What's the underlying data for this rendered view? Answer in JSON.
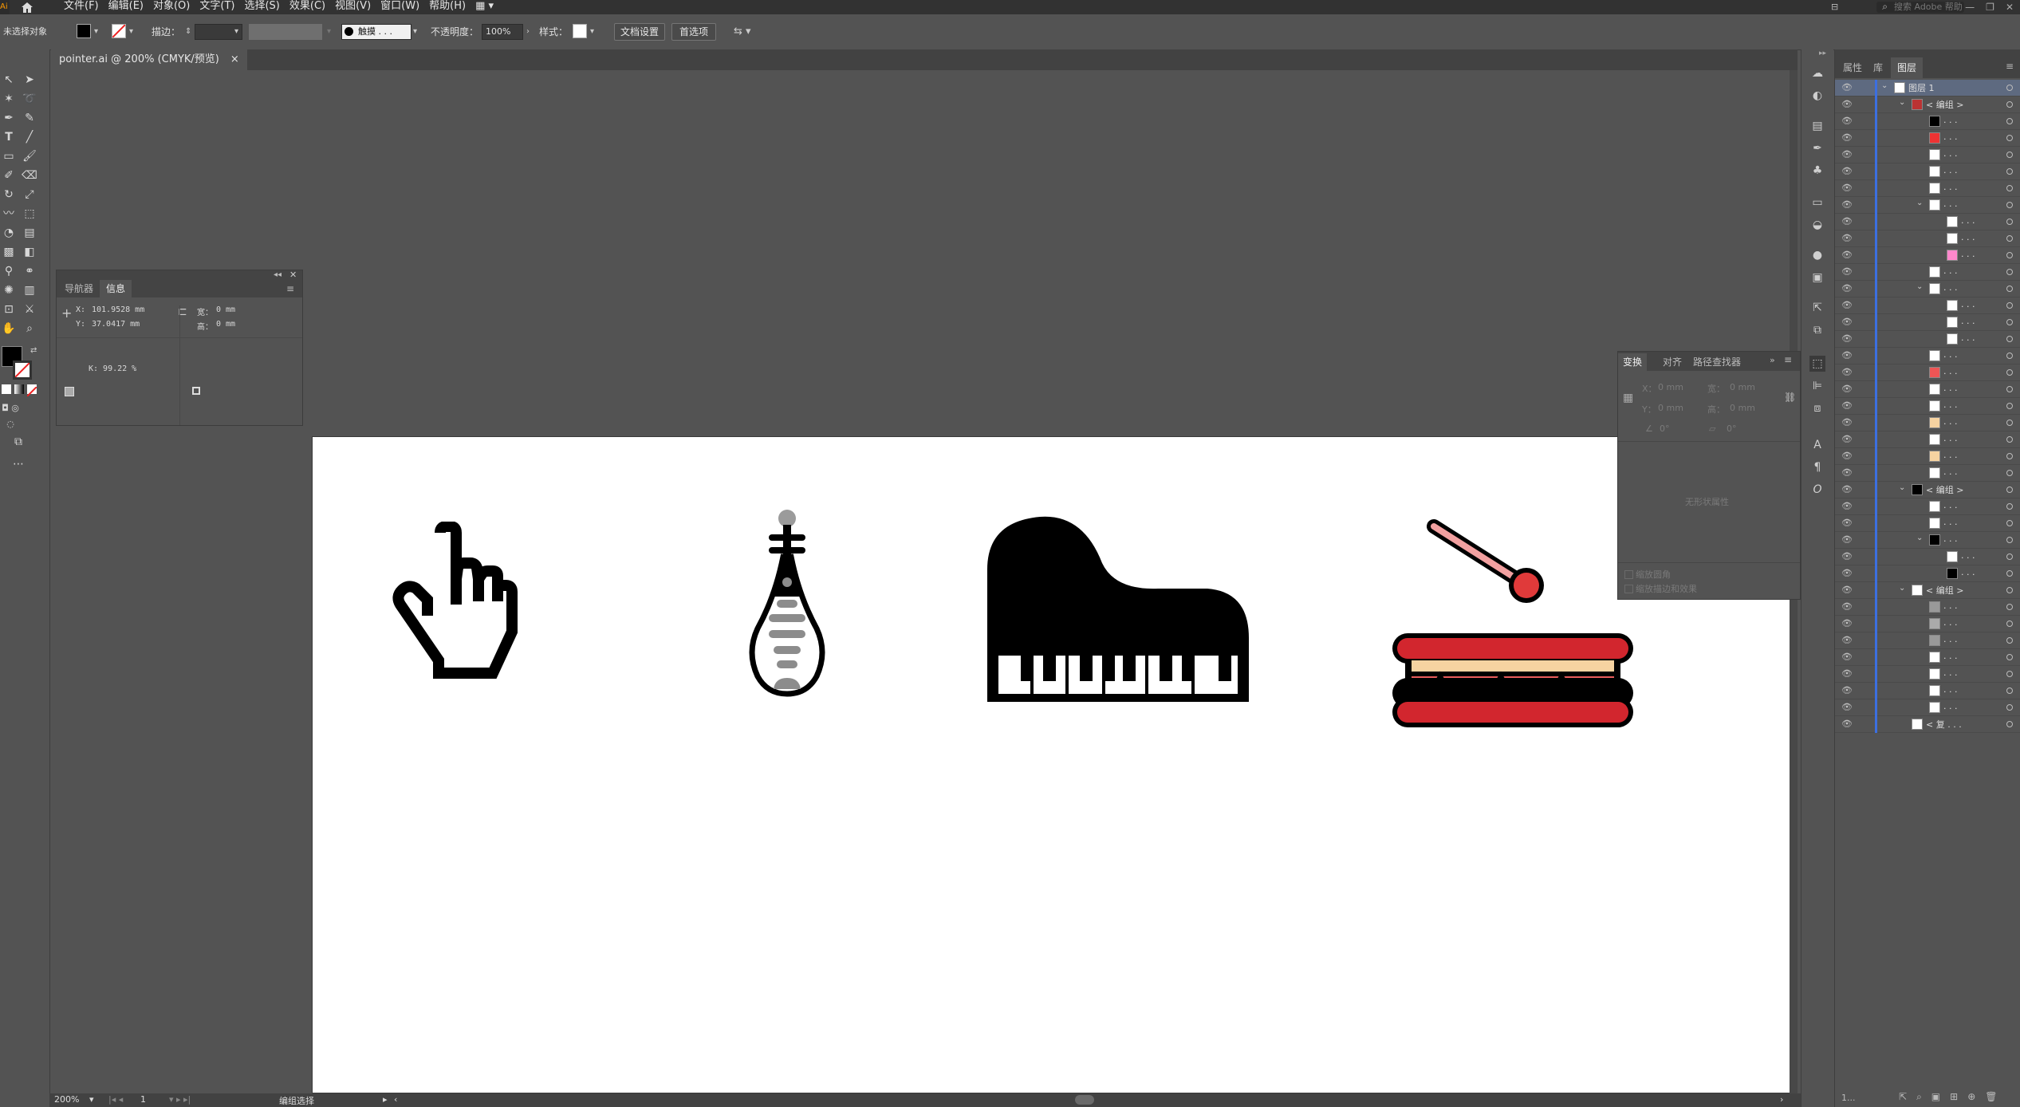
{
  "menubar": {
    "logo": "Ai",
    "items": [
      "文件(F)",
      "编辑(E)",
      "对象(O)",
      "文字(T)",
      "选择(S)",
      "效果(C)",
      "视图(V)",
      "窗口(W)",
      "帮助(H)"
    ],
    "search_placeholder": "搜索 Adobe 帮助"
  },
  "controlbar": {
    "selection": "未选择对象",
    "stroke_label": "描边：",
    "brush_label": "触摸 . . .",
    "opacity_label": "不透明度：",
    "opacity_value": "100%",
    "style_label": "样式：",
    "doc_setup": "文档设置",
    "preferences": "首选项"
  },
  "document": {
    "tab_title": "pointer.ai @ 200% (CMYK/预览)",
    "close": "×"
  },
  "info_panel": {
    "tab_navigator": "导航器",
    "tab_info": "信息",
    "x_label": "X:",
    "x_value": "101.9528 mm",
    "y_label": "Y:",
    "y_value": "37.0417 mm",
    "w_label": "宽：",
    "w_value": "0 mm",
    "h_label": "高：",
    "h_value": "0 mm",
    "k_value": "K: 99.22 %"
  },
  "transform_panel": {
    "tab_transform": "变换",
    "tab_align": "对齐",
    "tab_pathfinder": "路径查找器",
    "x_label": "X：",
    "x_value": "0 mm",
    "w_label": "宽：",
    "w_value": "0 mm",
    "y_label": "Y：",
    "y_value": "0 mm",
    "h_label": "高：",
    "h_value": "0 mm",
    "angle_value": "0°",
    "shear_value": "0°",
    "no_state": "无形状属性",
    "scale_corners": "缩放圆角",
    "scale_strokes": "缩放描边和效果"
  },
  "layers_panel": {
    "tab_properties": "属性",
    "tab_libraries": "库",
    "tab_layers": "图层",
    "layer1": "图层 1",
    "group": "< 编组 >",
    "ellipsis": ". . .",
    "compound": "< 复 . . .",
    "footer_count": "1..."
  },
  "statusbar": {
    "zoom": "200%",
    "page": "1",
    "tool": "编组选择"
  },
  "colors": {
    "accent_blue": "#3c6fe0",
    "drum_red": "#e85c5c",
    "drum_rim": "#d2262e",
    "drum_band": "#f6d3a1",
    "stick_pink": "#f2a0a0",
    "pipa_grey": "#8c8c8c"
  }
}
